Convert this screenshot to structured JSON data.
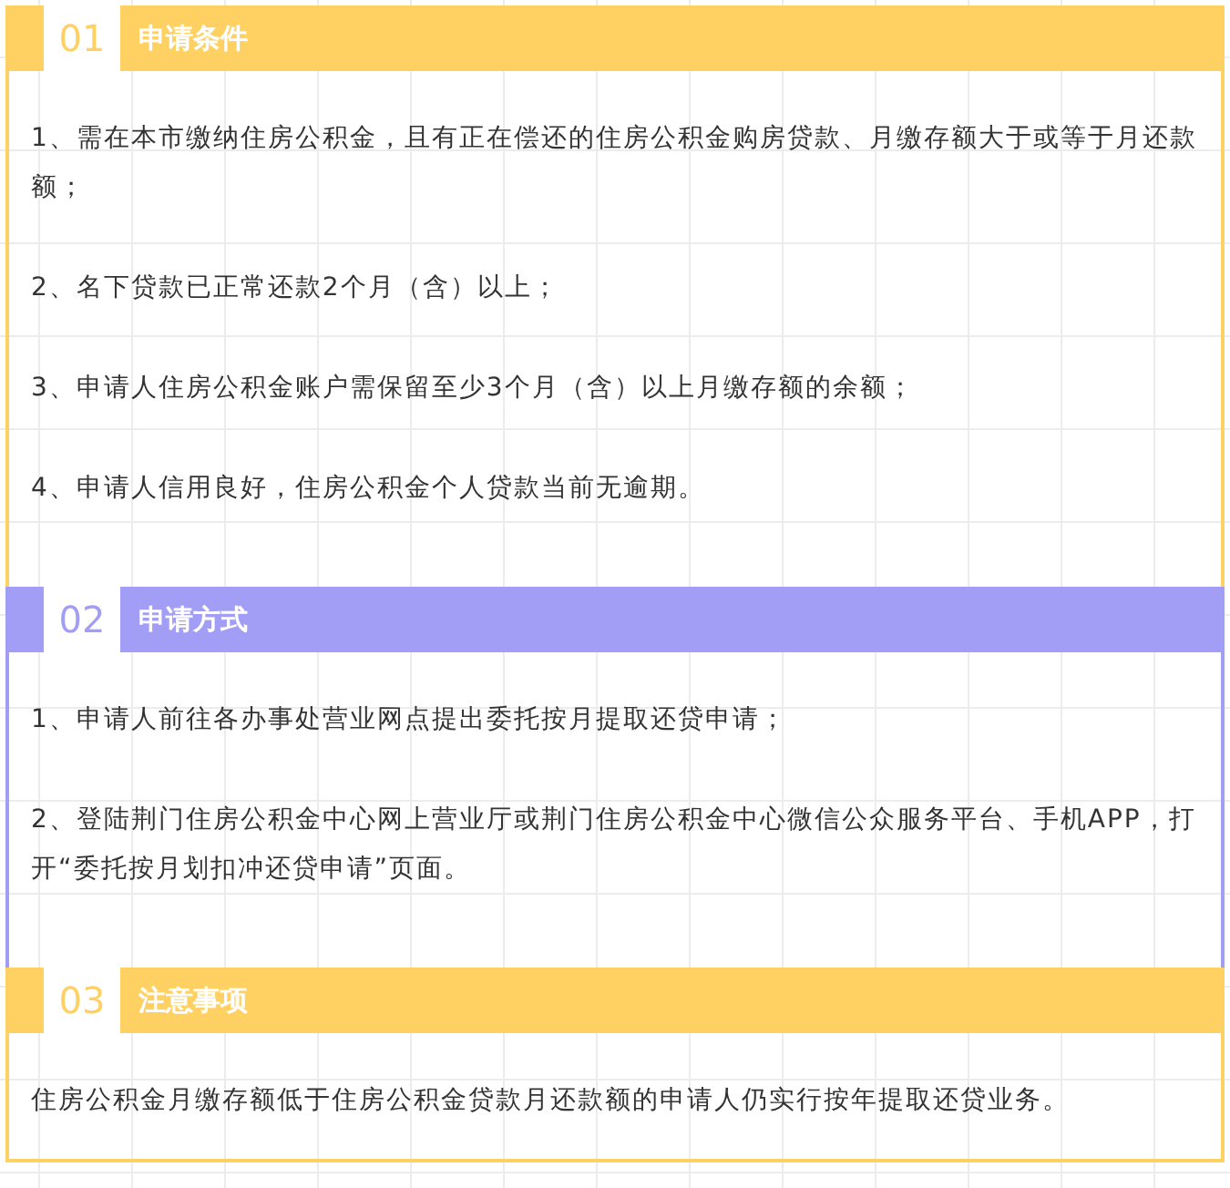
{
  "sections": [
    {
      "number": "01",
      "title": "申请条件",
      "color": "#ffd162",
      "paragraphs": [
        "1、需在本市缴纳住房公积金，且有正在偿还的住房公积金购房贷款、月缴存额大于或等于月还款额；",
        "2、名下贷款已正常还款2个月（含）以上；",
        "3、申请人住房公积金账户需保留至少3个月（含）以上月缴存额的余额；",
        "4、申请人信用良好，住房公积金个人贷款当前无逾期。"
      ]
    },
    {
      "number": "02",
      "title": "申请方式",
      "color": "#a29ef5",
      "paragraphs": [
        "1、申请人前往各办事处营业网点提出委托按月提取还贷申请；",
        "2、登陆荆门住房公积金中心网上营业厅或荆门住房公积金中心微信公众服务平台、手机APP，打开“委托按月划扣冲还贷申请”页面。"
      ]
    },
    {
      "number": "03",
      "title": "注意事项",
      "color": "#ffd162",
      "paragraphs": [
        "住房公积金月缴存额低于住房公积金贷款月还款额的申请人仍实行按年提取还贷业务。"
      ]
    }
  ]
}
